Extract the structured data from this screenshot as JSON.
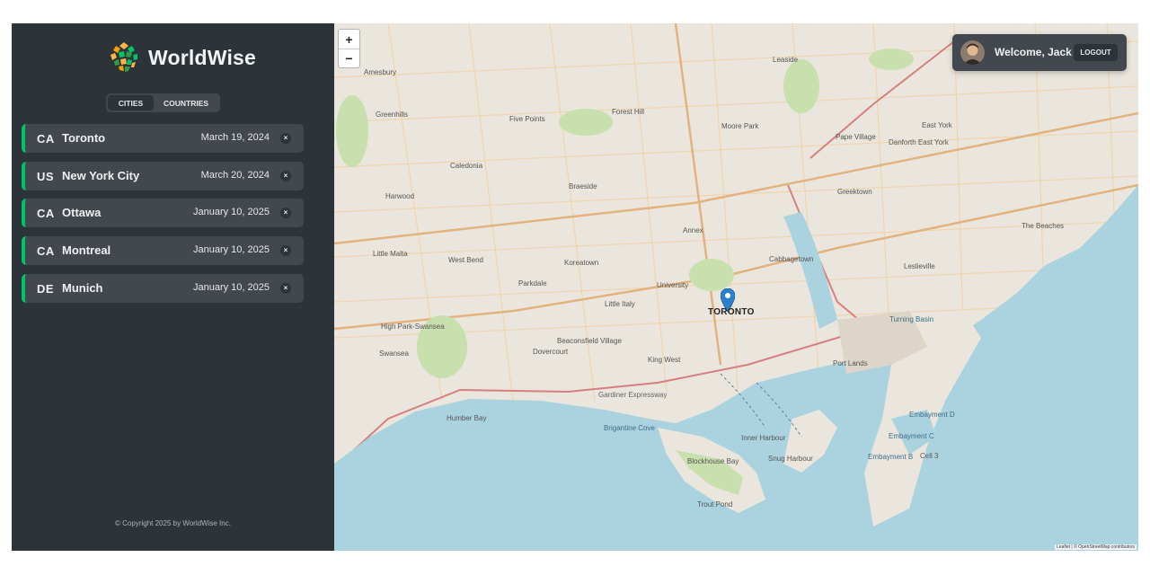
{
  "app": {
    "name": "WorldWise"
  },
  "tabs": [
    {
      "label": "CITIES",
      "active": true
    },
    {
      "label": "COUNTRIES",
      "active": false
    }
  ],
  "cities": [
    {
      "code": "CA",
      "name": "Toronto",
      "date": "March 19, 2024",
      "delete": "×"
    },
    {
      "code": "US",
      "name": "New York City",
      "date": "March 20, 2024",
      "delete": "×"
    },
    {
      "code": "CA",
      "name": "Ottawa",
      "date": "January 10, 2025",
      "delete": "×"
    },
    {
      "code": "CA",
      "name": "Montreal",
      "date": "January 10, 2025",
      "delete": "×"
    },
    {
      "code": "DE",
      "name": "Munich",
      "date": "January 10, 2025",
      "delete": "×"
    }
  ],
  "footer": {
    "copyright": "© Copyright 2025 by WorldWise Inc."
  },
  "map": {
    "zoom_in": "+",
    "zoom_out": "−",
    "marker_label": "TORONTO",
    "attribution": "Leaflet | © OpenStreetMap contributors",
    "water_color": "#aad3df",
    "land_color": "#eae6dd",
    "park_color": "#c8dfae",
    "labels": [
      "Inner Harbour",
      "Humber Bay",
      "Blockhouse Bay",
      "Snug Harbour",
      "Turning Basin",
      "Embayment D",
      "Embayment C",
      "Embayment B",
      "Cell 3",
      "Trout Pond",
      "Brigantine Cove",
      "Gardiner Expressway",
      "King West",
      "Little Italy",
      "University",
      "Cabbagetown",
      "Greektown",
      "Leslieville",
      "The Beaches",
      "Port Lands",
      "Danforth East York",
      "Pape Village",
      "East York",
      "Leaside",
      "Moore Park",
      "Forest Hill",
      "Annex",
      "Koreatown",
      "Parkdale",
      "Swansea",
      "High Park-Swansea",
      "Little Malta",
      "West Bend",
      "Caledonia",
      "Five Points",
      "Amesbury",
      "Harwood",
      "Greenhills",
      "Braeside",
      "Beaconsfield Village",
      "Dovercourt"
    ]
  },
  "user": {
    "welcome": "Welcome, Jack",
    "logout": "LOGOUT"
  },
  "colors": {
    "sidebar": "#2d3439",
    "card": "#42484d",
    "accent": "#00c46a"
  }
}
